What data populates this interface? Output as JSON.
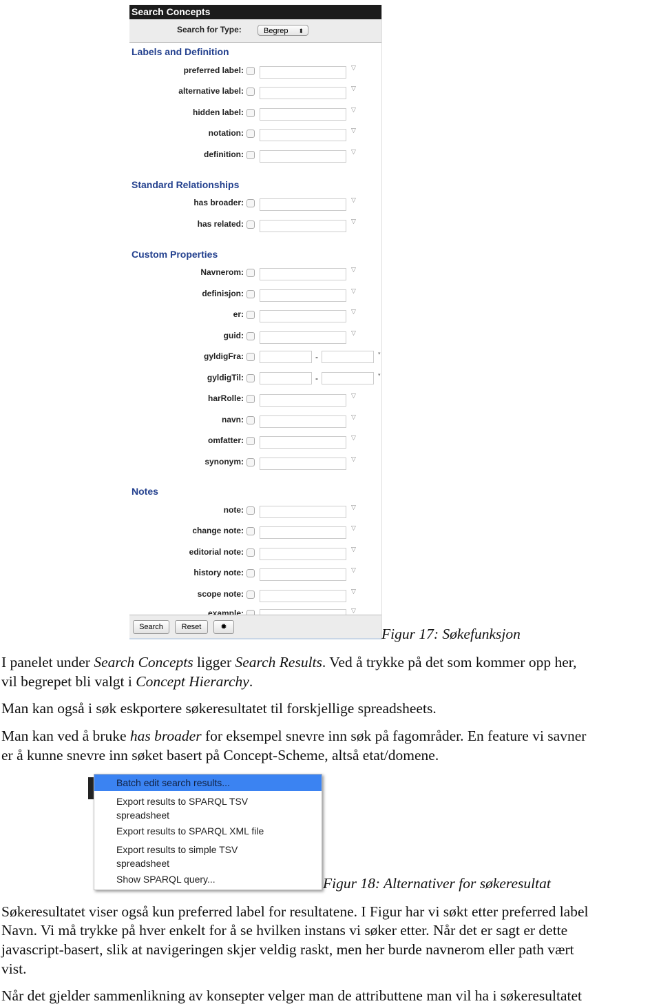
{
  "panel": {
    "title": "Search Concepts",
    "type_label": "Search for Type:",
    "type_value": "Begrep",
    "sections": [
      {
        "title": "Labels and Definition",
        "rows": [
          {
            "label": "preferred label:"
          },
          {
            "label": "alternative label:"
          },
          {
            "label": "hidden label:"
          },
          {
            "label": "notation:"
          },
          {
            "label": "definition:"
          }
        ]
      },
      {
        "title": "Standard Relationships",
        "rows": [
          {
            "label": "has broader:"
          },
          {
            "label": "has related:"
          }
        ]
      },
      {
        "title": "Custom Properties",
        "rows": [
          {
            "label": "Navnerom:"
          },
          {
            "label": "definisjon:"
          },
          {
            "label": "er:"
          },
          {
            "label": "guid:"
          },
          {
            "label": "gyldigFra:",
            "range": true
          },
          {
            "label": "gyldigTil:",
            "range": true
          },
          {
            "label": "harRolle:"
          },
          {
            "label": "navn:"
          },
          {
            "label": "omfatter:"
          },
          {
            "label": "synonym:"
          }
        ]
      },
      {
        "title": "Notes",
        "rows": [
          {
            "label": "note:"
          },
          {
            "label": "change note:"
          },
          {
            "label": "editorial note:"
          },
          {
            "label": "history note:"
          },
          {
            "label": "scope note:"
          },
          {
            "label": "example:"
          }
        ]
      }
    ],
    "search_button": "Search",
    "reset_button": "Reset",
    "settings_icon": "gear-icon"
  },
  "caption17": "Figur 17: Søkefunksjon",
  "text1": [
    [
      [
        "I panelet under ",
        0
      ],
      [
        "Search Concepts",
        1
      ],
      [
        " ligger  ",
        0
      ],
      [
        "Search Results",
        1
      ],
      [
        ". Ved å trykke på det som kommer opp her,",
        0
      ]
    ],
    [
      [
        "vil begrepet bli valgt i ",
        0
      ],
      [
        "Concept Hierarchy",
        1
      ],
      [
        ".",
        0
      ]
    ],
    [
      [
        "Man kan også i søk eskportere søkeresultatet til forskjellige spreadsheets.",
        0
      ]
    ],
    [
      [
        "Man kan ved å bruke ",
        0
      ],
      [
        "has broader",
        1
      ],
      [
        " for eksempel snevre inn søk på fagområder. En feature vi savner",
        0
      ]
    ],
    [
      [
        "er å kunne snevre inn søket basert på Concept-Scheme, altså etat/domene.",
        0
      ]
    ]
  ],
  "menu": {
    "items": [
      "Batch edit search results...",
      "Export results to SPARQL TSV spreadsheet",
      "Export results to SPARQL XML file",
      "Export results to simple TSV spreadsheet",
      "Show SPARQL query..."
    ],
    "highlight_color": "#3b83f2"
  },
  "caption18": "Figur 18: Alternativer for søkeresultat",
  "text2": [
    [
      [
        "Søkeresultatet viser også kun preferred label for resultatene. I  Figur har vi søkt etter preferred label",
        0
      ]
    ],
    [
      [
        "Navn. Vi må trykke på hver enkelt for å se hvilken instans vi søker etter. Når det er sagt er dette",
        0
      ]
    ],
    [
      [
        "javascript-basert, slik at navigeringen skjer veldig raskt, men her burde navnerom eller path vært",
        0
      ]
    ],
    [
      [
        "vist.",
        0
      ]
    ],
    [
      [
        "Når det gjelder sammenlikning av konsepter velger man de attributtene man vil ha i søkeresultatet",
        0
      ]
    ]
  ]
}
